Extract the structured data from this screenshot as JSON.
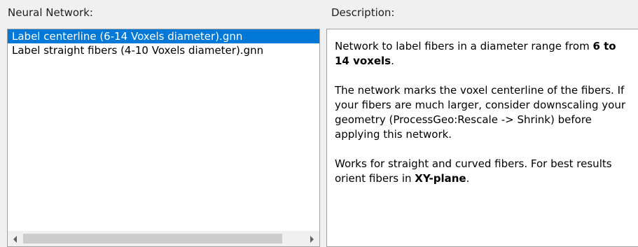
{
  "labels": {
    "neural_network": "Neural Network:",
    "description": "Description:"
  },
  "network_list": {
    "items": [
      {
        "label": "Label centerline (6-14 Voxels diameter).gnn",
        "selected": true
      },
      {
        "label": "Label straight fibers (4-10 Voxels diameter).gnn",
        "selected": false
      }
    ]
  },
  "description": {
    "p1_text": "Network to label fibers in a diameter range from ",
    "p1_bold": "6 to 14 voxels",
    "p1_end": ".",
    "p2_text": "The network marks the voxel centerline of the fibers. If your fibers are much larger, consider downscaling your geometry (ProcessGeo:Rescale -> Shrink) before applying this network.",
    "p3_text": "Works for straight and curved fibers. For best results orient fibers in ",
    "p3_bold": "XY-plane",
    "p3_end": "."
  },
  "colors": {
    "selection": "#0078d7",
    "window_bg": "#f0f0f0",
    "border": "#a0a0a0"
  },
  "icons": {
    "scroll_left": "triangle-left",
    "scroll_right": "triangle-right"
  }
}
